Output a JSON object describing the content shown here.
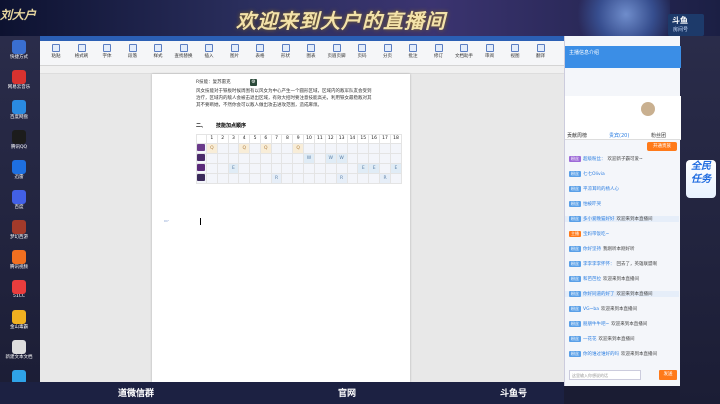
{
  "banner": {
    "left_text": "刘大户",
    "title": "欢迎来到大户的直播间",
    "badge_main": "斗鱼",
    "badge_sub": "房间号",
    "room_id": "182935"
  },
  "desktop_icons": [
    {
      "label": "快捷方式",
      "color": "#3a6fd0"
    },
    {
      "label": "网易云音乐",
      "color": "#d8322f"
    },
    {
      "label": "百度网盘",
      "color": "#2a8ae0"
    },
    {
      "label": "腾讯QQ",
      "color": "#1c1c1c"
    },
    {
      "label": "迅雷",
      "color": "#1e6fe0"
    },
    {
      "label": "百度",
      "color": "#4260e6"
    },
    {
      "label": "梦幻西游",
      "color": "#a23a2a"
    },
    {
      "label": "腾讯视频",
      "color": "#f06f20"
    },
    {
      "label": "51CC",
      "color": "#e93d3d"
    },
    {
      "label": "金山毒霸",
      "color": "#f0b020"
    },
    {
      "label": "新建文本文档",
      "color": "#dddddd"
    },
    {
      "label": "360",
      "color": "#2fa3e8"
    }
  ],
  "toolbar": [
    {
      "label": "粘贴"
    },
    {
      "label": "格式刷"
    },
    {
      "label": "字体"
    },
    {
      "label": "段落"
    },
    {
      "label": "样式"
    },
    {
      "label": "查找替换"
    },
    {
      "label": "插入"
    },
    {
      "label": "图片"
    },
    {
      "label": "表格"
    },
    {
      "label": "形状"
    },
    {
      "label": "图表"
    },
    {
      "label": "页眉页脚"
    },
    {
      "label": "页码"
    },
    {
      "label": "分页"
    },
    {
      "label": "批注"
    },
    {
      "label": "修订"
    },
    {
      "label": "文档助手"
    },
    {
      "label": "审阅"
    },
    {
      "label": "视图"
    },
    {
      "label": "翻译"
    }
  ],
  "doc": {
    "line1": "R技能：复苏雷克",
    "line2": "风女技能对于铁板时候周围有以风女为中心产生一个圆形区域，区域内的敌军队友会受到",
    "line3": "治疗，区域内的敌人会被击退出区域，有效大招时要注意技能高光，利用铁女最稳敌对其",
    "line4": "其不要断她，不然你会可以敌人做出攻击进攻范围，造成麻烦。",
    "section_no": "二、",
    "section_title": "技能加点顺序"
  },
  "skill_table": {
    "levels": [
      "1",
      "2",
      "3",
      "4",
      "5",
      "6",
      "7",
      "8",
      "9",
      "10",
      "11",
      "12",
      "13",
      "14",
      "15",
      "16",
      "17",
      "18"
    ],
    "rows": [
      {
        "champ_color": "#6a3a8a",
        "cells": [
          "Q",
          "",
          "",
          "Q",
          "",
          "Q",
          "",
          "",
          "Q",
          "",
          "",
          "",
          "",
          "",
          "",
          "",
          "",
          ""
        ]
      },
      {
        "champ_color": "#4a2a6a",
        "cells": [
          "",
          "",
          "",
          "",
          "",
          "",
          "",
          "",
          "",
          "W",
          "",
          "W",
          "W",
          "",
          "",
          "",
          "",
          ""
        ]
      },
      {
        "champ_color": "#5a2a7a",
        "cells": [
          "",
          "",
          "E",
          "",
          "",
          "",
          "",
          "",
          "",
          "",
          "",
          "",
          "",
          "",
          "E",
          "E",
          "",
          "E"
        ]
      },
      {
        "champ_color": "#3a2a5a",
        "cells": [
          "",
          "",
          "",
          "",
          "",
          "",
          "R",
          "",
          "",
          "",
          "",
          "",
          "R",
          "",
          "",
          "",
          "R",
          ""
        ]
      }
    ]
  },
  "status": {
    "left": "道微信群",
    "mid": "官网",
    "right": "斗鱼号"
  },
  "panel": {
    "title": "主播信息介绍",
    "tabs": [
      "贡献周榜",
      "贵宾(20)",
      "粉丝团"
    ],
    "open_btn": "开通贵族",
    "messages": [
      {
        "tag": "粉丝",
        "tag_color": "#9e6bd8",
        "nick": "超级粉丝：",
        "text": "欢迎新子霸可爱~",
        "hl": false
      },
      {
        "tag": "粉丝",
        "tag_color": "#5aa0e8",
        "nick": "七七Olivia",
        "text": "",
        "hl": false
      },
      {
        "tag": "粉丝",
        "tag_color": "#5aa0e8",
        "nick": "平凉耳鸣的杨人心",
        "text": "",
        "hl": false
      },
      {
        "tag": "粉丝",
        "tag_color": "#5aa0e8",
        "nick": "怕被吓哭",
        "text": "",
        "hl": false
      },
      {
        "tag": "粉丝",
        "tag_color": "#5aa0e8",
        "nick": "多小爱晚猫好好",
        "text": "欢迎来到本直播间",
        "hl": true
      },
      {
        "tag": "主播",
        "tag_color": "#ff7a1a",
        "nick": "宝妈带饭吃~",
        "text": "",
        "hl": false
      },
      {
        "tag": "粉丝",
        "tag_color": "#5aa0e8",
        "nick": "你好坚持",
        "text": "我刚听本刚好听",
        "hl": false
      },
      {
        "tag": "粉丝",
        "tag_color": "#5aa0e8",
        "nick": "李李李李怀怀：",
        "text": "回去了，英雄联盟啊",
        "hl": false
      },
      {
        "tag": "粉丝",
        "tag_color": "#5aa0e8",
        "nick": "和芭芭拉",
        "text": "欢迎来到本直播间",
        "hl": false
      },
      {
        "tag": "粉丝",
        "tag_color": "#5aa0e8",
        "nick": "你好同道的好了",
        "text": "欢迎来到本直播间",
        "hl": true
      },
      {
        "tag": "粉丝",
        "tag_color": "#5aa0e8",
        "nick": "VG~ba",
        "text": "欢迎来到本直播间",
        "hl": false
      },
      {
        "tag": "粉丝",
        "tag_color": "#5aa0e8",
        "nick": "朋朋牛牛吧~",
        "text": "欢迎来到本直播间",
        "hl": false
      },
      {
        "tag": "粉丝",
        "tag_color": "#5aa0e8",
        "nick": "一花花",
        "text": "欢迎来到本直播间",
        "hl": false
      },
      {
        "tag": "粉丝",
        "tag_color": "#5aa0e8",
        "nick": "你的谁过谁好的吗",
        "text": "欢迎来到本直播间",
        "hl": false
      }
    ],
    "input_placeholder": "这里输入你想说的话",
    "send": "发送"
  },
  "ad": {
    "line1": "全民",
    "line2": "任务"
  }
}
